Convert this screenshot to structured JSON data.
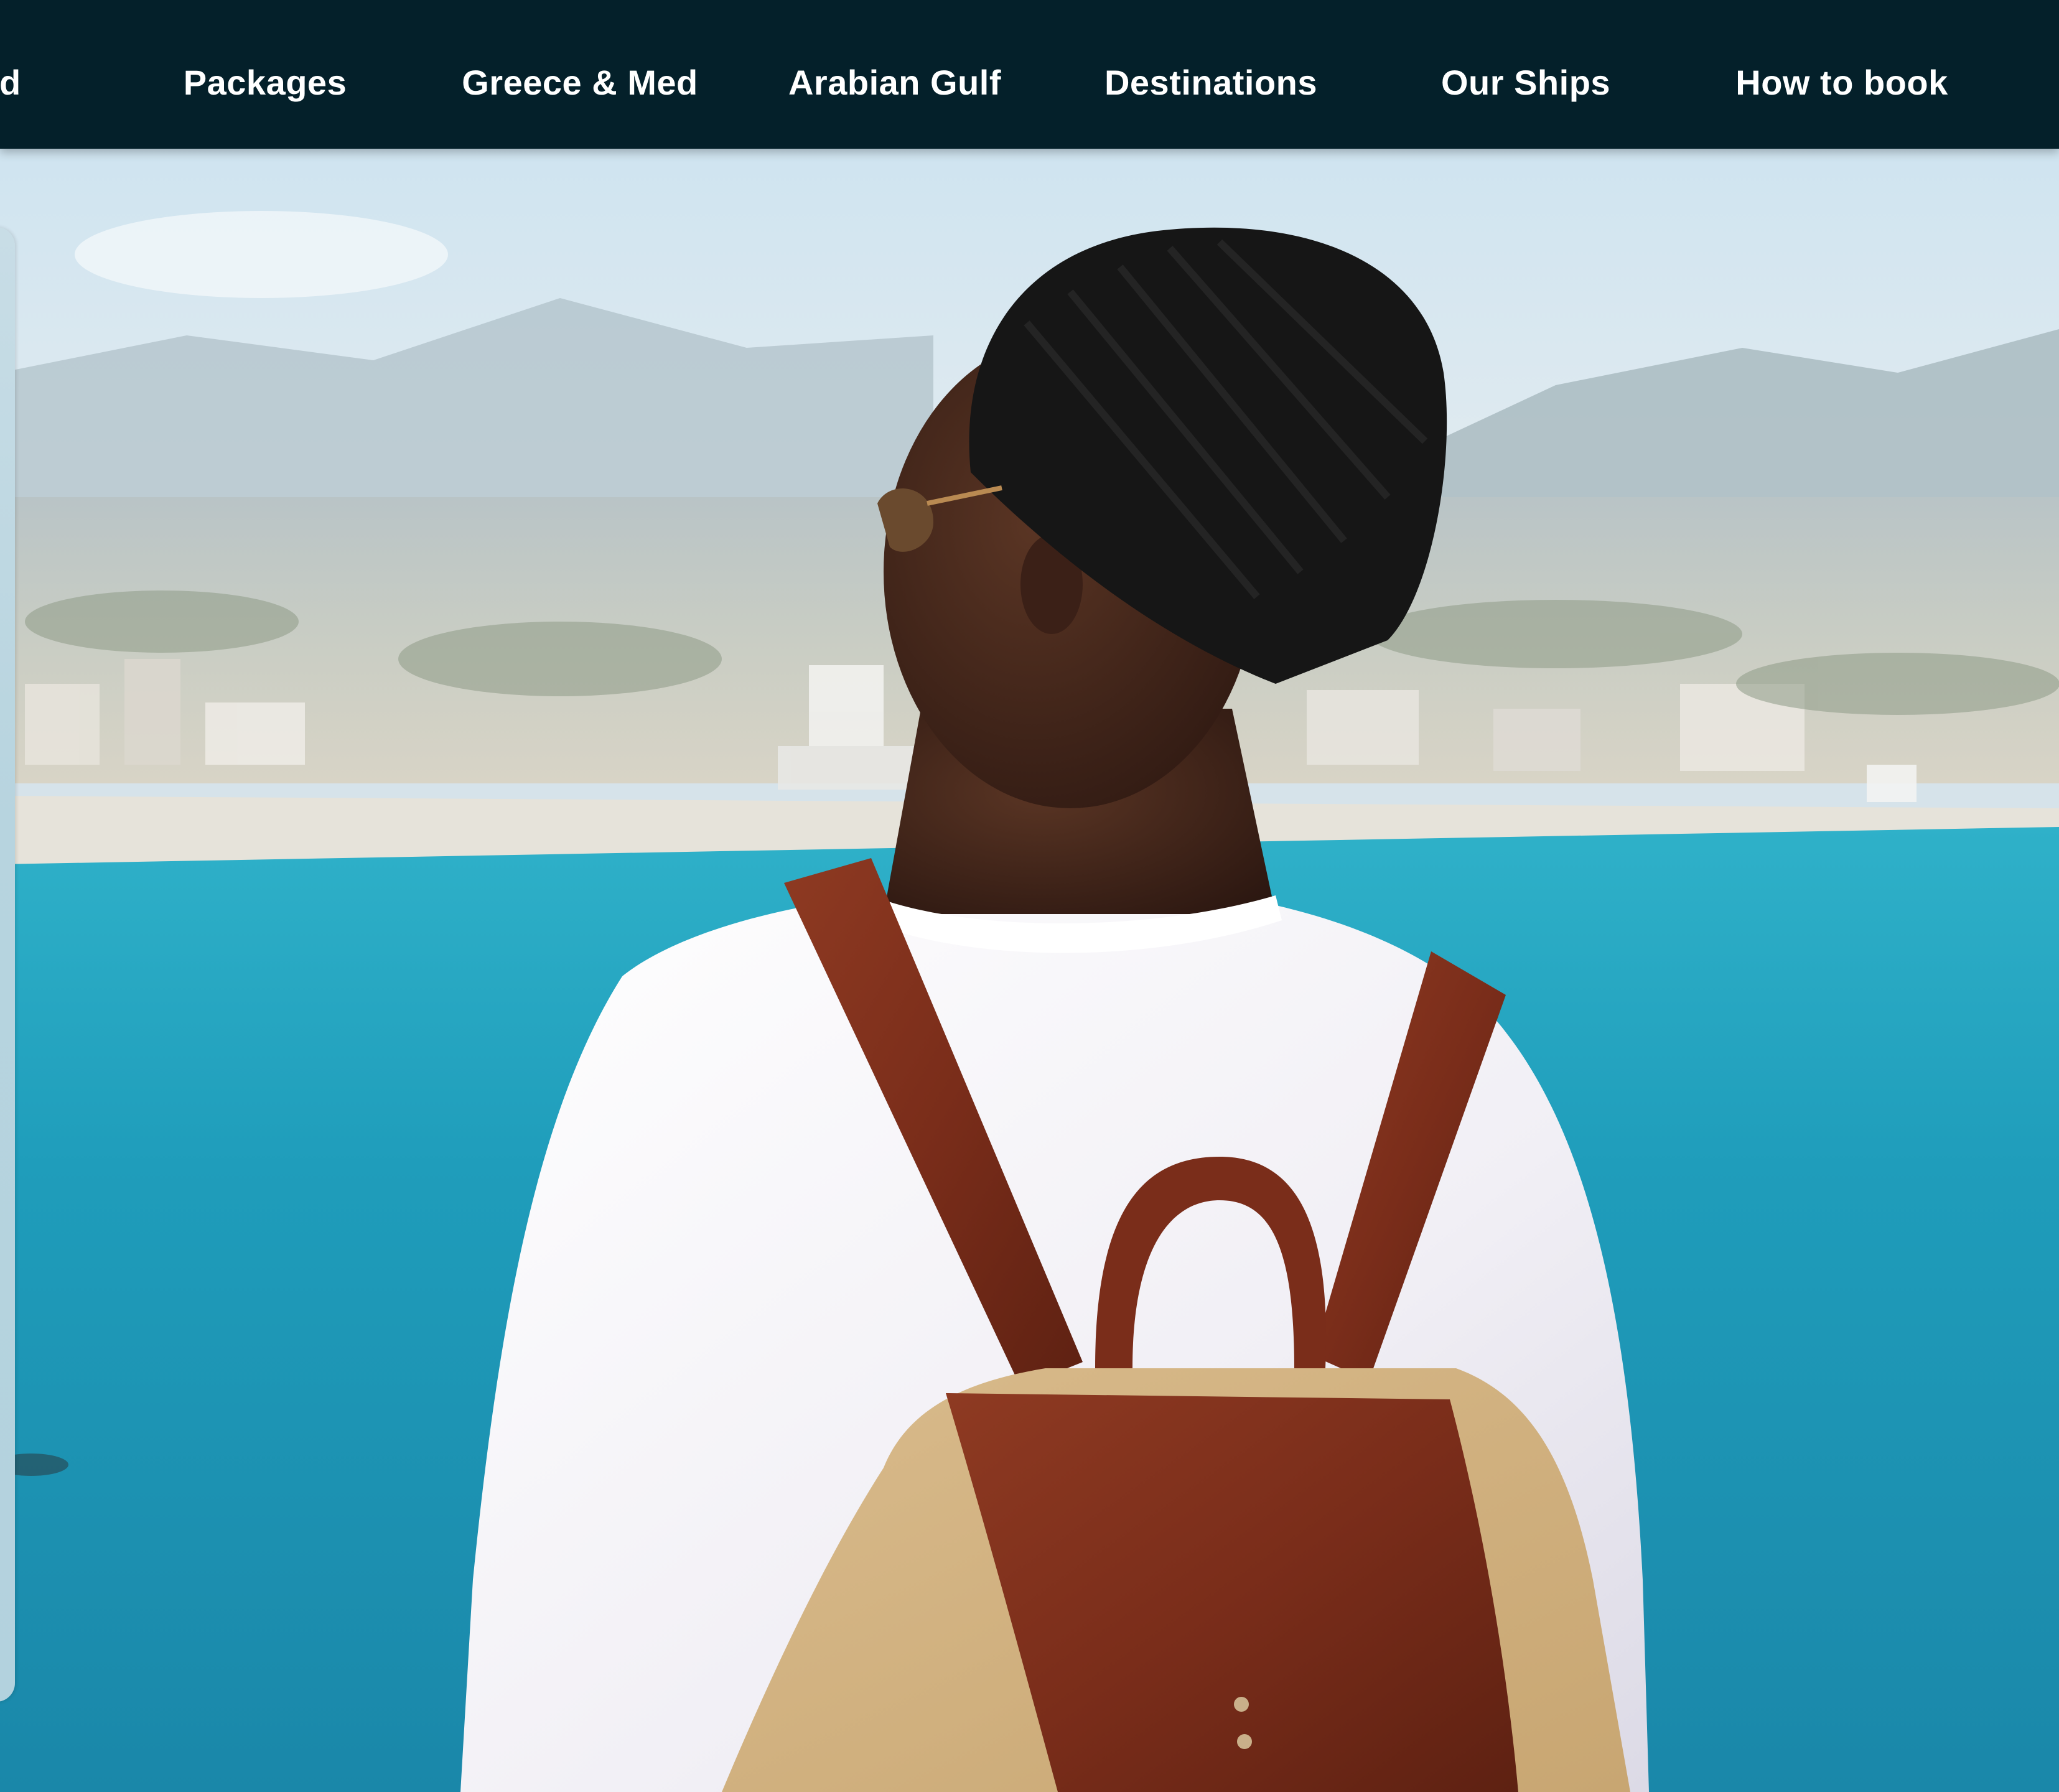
{
  "nav": {
    "items": [
      {
        "label": "rd"
      },
      {
        "label": "Packages"
      },
      {
        "label": "Greece & Med"
      },
      {
        "label": "Arabian Gulf"
      },
      {
        "label": "Destinations"
      },
      {
        "label": "Our Ships"
      },
      {
        "label": "How to book"
      }
    ]
  },
  "colors": {
    "nav_background": "#04202a",
    "nav_text": "#ffffff",
    "sea": "#1e97b6"
  },
  "hero": {
    "image_subject": "traveller-with-backpack-overlooking-coastal-town"
  }
}
